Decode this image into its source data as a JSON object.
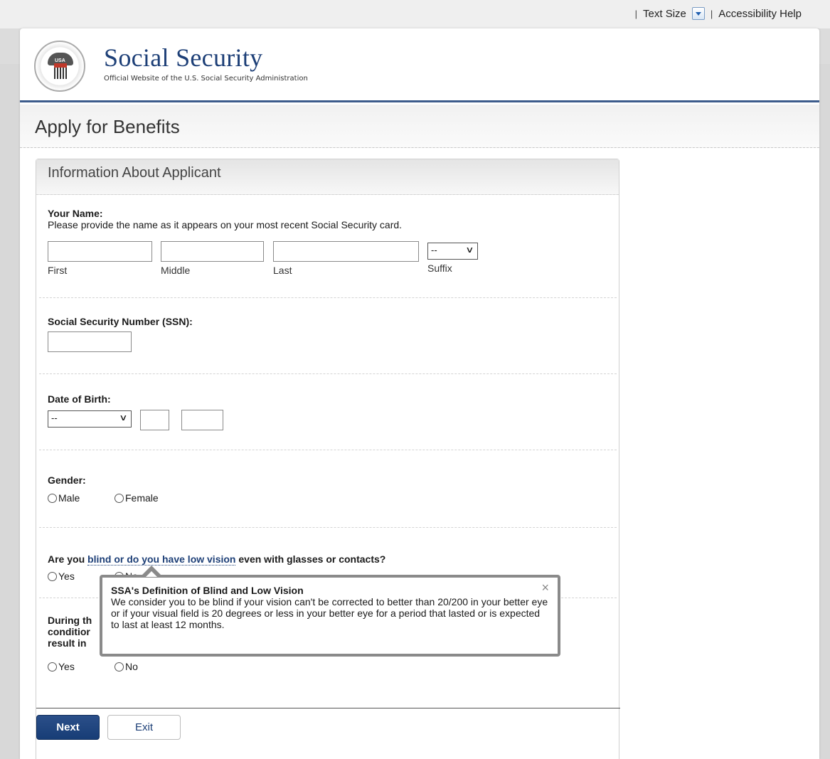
{
  "utility": {
    "text_size": "Text Size",
    "accessibility_help": "Accessibility Help"
  },
  "brand": {
    "title": "Social Security",
    "subtitle": "Official Website of the U.S. Social Security Administration",
    "seal_text": "USA"
  },
  "page": {
    "heading": "Apply for Benefits"
  },
  "card": {
    "heading": "Information About Applicant",
    "name": {
      "label": "Your Name:",
      "help": "Please provide the name as it appears on your most recent Social Security card.",
      "first": "First",
      "middle": "Middle",
      "last": "Last",
      "suffix": "Suffix",
      "suffix_value": "--"
    },
    "ssn": {
      "label": "Social Security Number (SSN):"
    },
    "dob": {
      "label": "Date of Birth:",
      "month_value": "--"
    },
    "gender": {
      "label": "Gender:",
      "male": "Male",
      "female": "Female"
    },
    "blind": {
      "prefix": "Are you ",
      "link": "blind or do you have low vision",
      "suffix": " even with glasses or contacts?",
      "yes": "Yes",
      "no": "No"
    },
    "during": {
      "line1": "During th",
      "line2": "conditior",
      "line3": "result in",
      "yes": "Yes",
      "no": "No"
    }
  },
  "tooltip": {
    "title": "SSA's Definition of Blind and Low Vision",
    "body": "We consider you to be blind if your vision can't be corrected to better than 20/200 in your better eye or if your visual field is 20 degrees or less in your better eye for a period that lasted or is expected to last at least 12 months.",
    "close": "×"
  },
  "buttons": {
    "next": "Next",
    "exit": "Exit"
  }
}
